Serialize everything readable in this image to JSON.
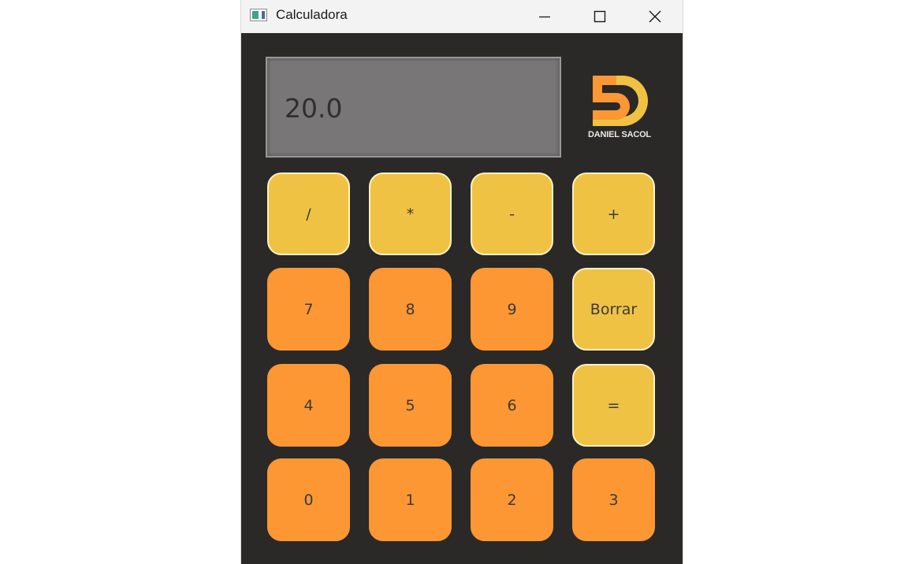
{
  "window": {
    "title": "Calculadora"
  },
  "display": {
    "value": "20.0"
  },
  "logo": {
    "text": "DANIEL SACOL",
    "colors": {
      "primary": "#fc9733",
      "secondary": "#f0c244"
    }
  },
  "buttons": {
    "divide": "/",
    "multiply": "*",
    "subtract": "-",
    "add": "+",
    "seven": "7",
    "eight": "8",
    "nine": "9",
    "clear": "Borrar",
    "four": "4",
    "five": "5",
    "six": "6",
    "equals": "=",
    "zero": "0",
    "one": "1",
    "two": "2",
    "three": "3"
  },
  "colors": {
    "background": "#2a2927",
    "operator": "#f0c244",
    "digit": "#fc9733",
    "display": "#787676"
  }
}
